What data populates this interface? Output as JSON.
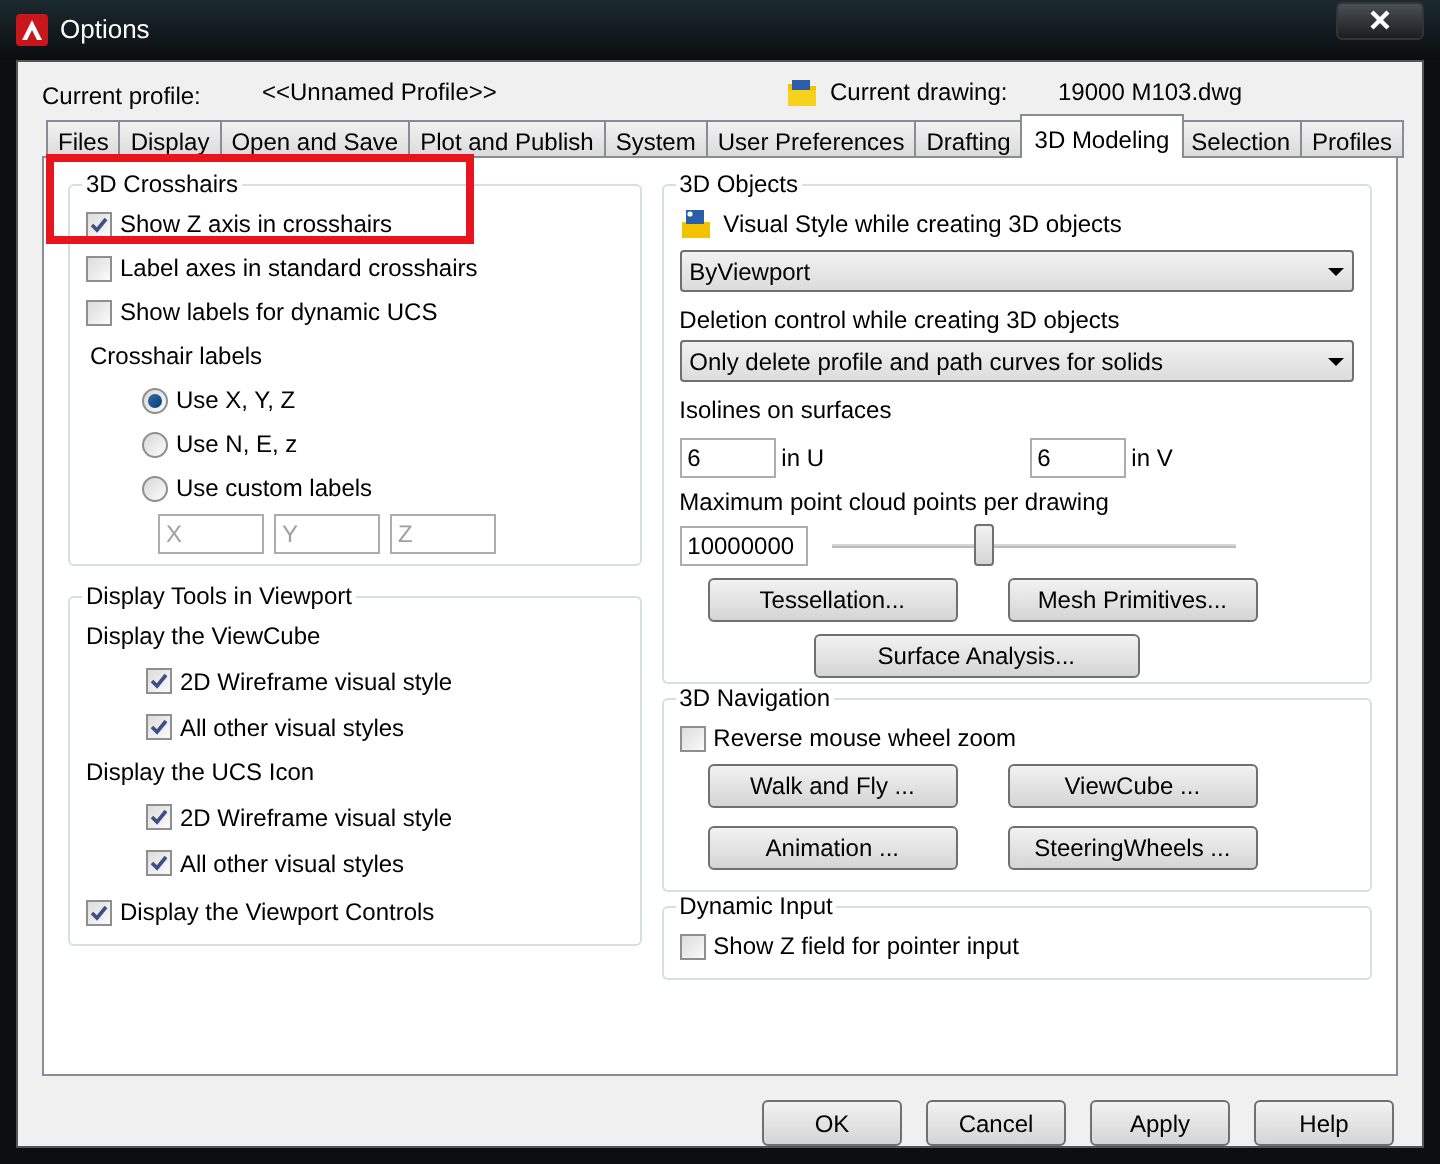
{
  "window": {
    "title": "Options"
  },
  "profile": {
    "label": "Current profile:",
    "value": "<<Unnamed Profile>>"
  },
  "drawing": {
    "label": "Current drawing:",
    "value": "19000 M103.dwg"
  },
  "tabs": [
    {
      "label": "Files",
      "selected": false
    },
    {
      "label": "Display",
      "selected": false
    },
    {
      "label": "Open and Save",
      "selected": false
    },
    {
      "label": "Plot and Publish",
      "selected": false
    },
    {
      "label": "System",
      "selected": false
    },
    {
      "label": "User Preferences",
      "selected": false
    },
    {
      "label": "Drafting",
      "selected": false
    },
    {
      "label": "3D Modeling",
      "selected": true
    },
    {
      "label": "Selection",
      "selected": false
    },
    {
      "label": "Profiles",
      "selected": false
    }
  ],
  "crosshairs": {
    "title": "3D Crosshairs",
    "highlighted": true,
    "checkboxes": [
      {
        "label": "Show Z axis in crosshairs",
        "checked": true
      },
      {
        "label": "Label axes in standard crosshairs",
        "checked": false
      },
      {
        "label": "Show labels for dynamic UCS",
        "checked": false
      }
    ],
    "labels_heading": "Crosshair labels",
    "radios": [
      {
        "label": "Use X, Y, Z",
        "selected": true
      },
      {
        "label": "Use N, E, z",
        "selected": false
      },
      {
        "label": "Use custom labels",
        "selected": false
      }
    ],
    "custom_fields": [
      {
        "placeholder": "X"
      },
      {
        "placeholder": "Y"
      },
      {
        "placeholder": "Z"
      }
    ]
  },
  "display_tools": {
    "title": "Display Tools in Viewport",
    "items": [
      {
        "kind": "heading",
        "label": "Display the ViewCube",
        "children": [
          {
            "label": "2D Wireframe visual style",
            "checked": true
          },
          {
            "label": "All other visual styles",
            "checked": true
          }
        ]
      },
      {
        "kind": "heading",
        "label": "Display the UCS Icon",
        "children": [
          {
            "label": "2D Wireframe visual style",
            "checked": true
          },
          {
            "label": "All other visual styles",
            "checked": true
          }
        ]
      },
      {
        "kind": "checkbox",
        "label": "Display the Viewport Controls",
        "checked": true
      }
    ]
  },
  "objects": {
    "title": "3D Objects",
    "visual_style_label": "Visual Style while creating 3D objects",
    "visual_style_value": "ByViewport",
    "deletion_label": "Deletion control while creating 3D objects",
    "deletion_value": "Only delete profile and path curves for solids",
    "isolines_label": "Isolines on surfaces",
    "u_value": "6",
    "u_label": "in U",
    "v_value": "6",
    "v_label": "in V",
    "cloud_label": "Maximum point cloud points per drawing",
    "cloud_value": "10000000",
    "cloud_slider": {
      "level": 0.38
    },
    "buttons": [
      "Tessellation...",
      "Mesh Primitives...",
      "Surface Analysis..."
    ]
  },
  "navigation": {
    "title": "3D Navigation",
    "checkbox": {
      "label": "Reverse mouse wheel zoom",
      "checked": false
    },
    "buttons": [
      "Walk and Fly ...",
      "ViewCube ...",
      "Animation ...",
      "SteeringWheels ..."
    ]
  },
  "dynamic_input": {
    "title": "Dynamic Input",
    "checkbox": {
      "label": "Show Z field for pointer input",
      "checked": false
    }
  },
  "footer_buttons": [
    "OK",
    "Cancel",
    "Apply",
    "Help"
  ]
}
